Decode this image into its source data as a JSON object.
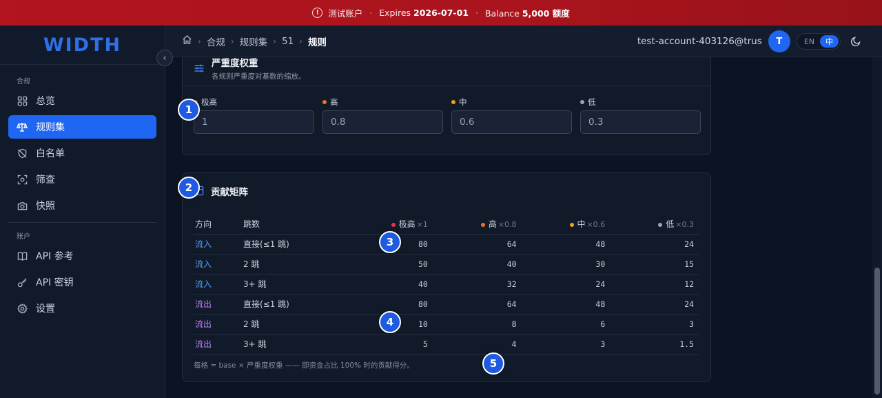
{
  "banner": {
    "account": "测试账户",
    "dot": "·",
    "expires_label": "Expires",
    "expires_value": "2026-07-01",
    "balance_label": "Balance",
    "balance_value": "5,000 额度",
    "accent": "#b3141f"
  },
  "logo": "WIDTH",
  "sidebar": {
    "section1": "合规",
    "items1": [
      {
        "label": "总览",
        "icon": "grid-icon"
      },
      {
        "label": "规则集",
        "icon": "scale-icon",
        "active": true
      },
      {
        "label": "白名单",
        "icon": "shield-off-icon"
      },
      {
        "label": "筛查",
        "icon": "scan-icon"
      },
      {
        "label": "快照",
        "icon": "camera-icon"
      }
    ],
    "section2": "账户",
    "items2": [
      {
        "label": "API 参考",
        "icon": "book-icon"
      },
      {
        "label": "API 密钥",
        "icon": "key-icon"
      },
      {
        "label": "设置",
        "icon": "gear-icon"
      }
    ]
  },
  "breadcrumb": [
    "合规",
    "规则集",
    "51",
    "规则"
  ],
  "header": {
    "email": "test-account-403126@trus…",
    "avatar": "T",
    "lang_en": "EN",
    "lang_zh": "中"
  },
  "severity": {
    "title": "严重度权重",
    "subtitle": "各规则严重度对基数的缩放。",
    "fields": [
      {
        "label": "极高",
        "value": "1",
        "color": "#e5334a"
      },
      {
        "label": "高",
        "value": "0.8",
        "color": "#f0702a"
      },
      {
        "label": "中",
        "value": "0.6",
        "color": "#f0a020"
      },
      {
        "label": "低",
        "value": "0.3",
        "color": "#9aa4b5"
      }
    ]
  },
  "matrix": {
    "title": "贡献矩阵",
    "columns": {
      "direction": "方向",
      "hops": "跳数",
      "c1": "极高",
      "c1m": "×1",
      "c2": "高",
      "c2m": "×0.8",
      "c3": "中",
      "c3m": "×0.6",
      "c4": "低",
      "c4m": "×0.3"
    },
    "rows": [
      {
        "dir": "流入",
        "hops": "直接(≤1 跳)",
        "v": [
          "80",
          "64",
          "48",
          "24"
        ]
      },
      {
        "dir": "流入",
        "hops": "2 跳",
        "v": [
          "50",
          "40",
          "30",
          "15"
        ]
      },
      {
        "dir": "流入",
        "hops": "3+ 跳",
        "v": [
          "40",
          "32",
          "24",
          "12"
        ]
      },
      {
        "dir": "流出",
        "hops": "直接(≤1 跳)",
        "v": [
          "80",
          "64",
          "48",
          "24"
        ]
      },
      {
        "dir": "流出",
        "hops": "2 跳",
        "v": [
          "10",
          "8",
          "6",
          "3"
        ]
      },
      {
        "dir": "流出",
        "hops": "3+ 跳",
        "v": [
          "5",
          "4",
          "3",
          "1.5"
        ]
      }
    ],
    "footnote": "每格 = base × 严重度权重 —— 即资金占比 100% 时的贡献得分。"
  },
  "markers": [
    "1",
    "2",
    "3",
    "4",
    "5"
  ]
}
